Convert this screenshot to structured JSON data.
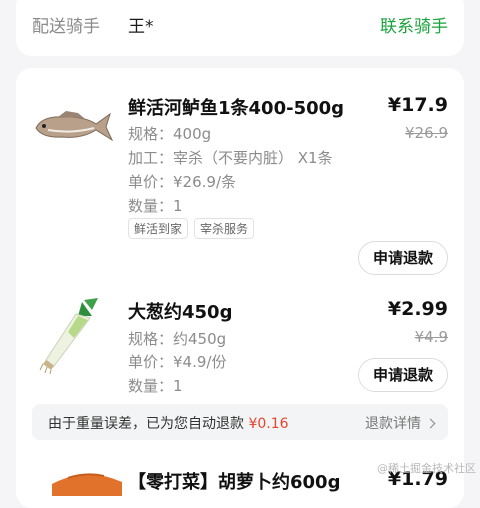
{
  "rider": {
    "label": "配送骑手",
    "name": "王*",
    "contact": "联系骑手"
  },
  "items": [
    {
      "title": "鲜活河鲈鱼1条400-500g",
      "price": "¥17.9",
      "original_price": "¥26.9",
      "spec": "规格：400g",
      "process": "加工：宰杀（不要内脏） X1条",
      "unit_price": "单价：¥26.9/条",
      "quantity": "数量：1",
      "tags": [
        "鲜活到家",
        "宰杀服务"
      ],
      "refund_button": "申请退款",
      "image_icon": "fish-icon"
    },
    {
      "title": "大葱约450g",
      "price": "¥2.99",
      "original_price": "¥4.9",
      "spec": "规格：约450g",
      "unit_price": "单价：¥4.9/份",
      "quantity": "数量：1",
      "refund_button": "申请退款",
      "image_icon": "scallion-icon"
    },
    {
      "title": "【零打菜】胡萝卜约600g",
      "price": "¥1.79",
      "image_icon": "carrot-icon"
    }
  ],
  "notice": {
    "text": "由于重量误差，已为您自动退款",
    "amount": "¥0.16",
    "link": "退款详情"
  },
  "watermark": "@稀土掘金技术社区"
}
